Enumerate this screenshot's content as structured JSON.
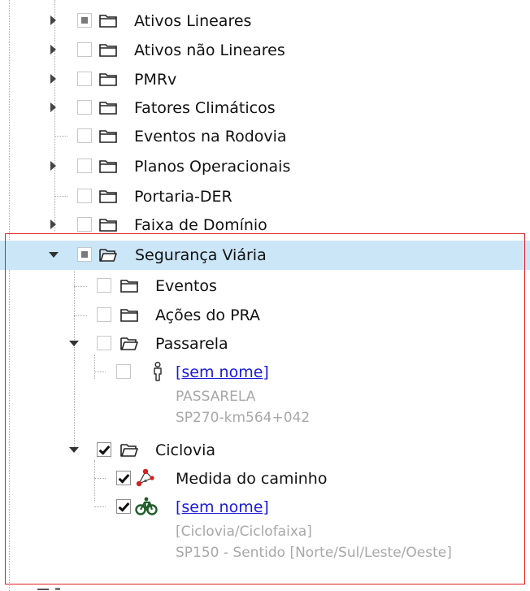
{
  "tree": {
    "items": [
      {
        "label": "Ativos Lineares",
        "state": "mixed",
        "expander": "collapsed",
        "icon": "folder-closed-icon"
      },
      {
        "label": "Ativos não Lineares",
        "state": "unchecked",
        "expander": "collapsed",
        "icon": "folder-closed-icon"
      },
      {
        "label": "PMRv",
        "state": "unchecked",
        "expander": "collapsed",
        "icon": "folder-closed-icon"
      },
      {
        "label": "Fatores Climáticos",
        "state": "unchecked",
        "expander": "collapsed",
        "icon": "folder-closed-icon"
      },
      {
        "label": "Eventos na Rodovia",
        "state": "unchecked",
        "expander": "none",
        "icon": "folder-closed-icon"
      },
      {
        "label": "Planos Operacionais",
        "state": "unchecked",
        "expander": "collapsed",
        "icon": "folder-closed-icon"
      },
      {
        "label": "Portaria-DER",
        "state": "unchecked",
        "expander": "none",
        "icon": "folder-closed-icon"
      },
      {
        "label": "Faixa de Domínio",
        "state": "unchecked",
        "expander": "collapsed",
        "icon": "folder-closed-icon"
      },
      {
        "label": "Segurança Viária",
        "state": "mixed",
        "expander": "expanded",
        "icon": "folder-open-icon",
        "selected": true
      },
      {
        "label": "Eventos",
        "state": "unchecked",
        "expander": "none",
        "icon": "folder-closed-icon"
      },
      {
        "label": "Ações do PRA",
        "state": "unchecked",
        "expander": "none",
        "icon": "folder-closed-icon"
      },
      {
        "label": "Passarela",
        "state": "unchecked",
        "expander": "expanded",
        "icon": "folder-open-icon"
      },
      {
        "label": "[sem nome]",
        "state": "unchecked",
        "expander": "none",
        "icon": "pedestrian-icon",
        "link": true,
        "details": [
          "PASSARELA",
          "SP270-km564+042"
        ]
      },
      {
        "label": "Ciclovia",
        "state": "checked",
        "expander": "expanded",
        "icon": "folder-open-icon"
      },
      {
        "label": "Medida do caminho",
        "state": "checked",
        "expander": "none",
        "icon": "path-measure-icon"
      },
      {
        "label": "[sem nome]",
        "state": "checked",
        "expander": "none",
        "icon": "bicycle-icon",
        "link": true,
        "details": [
          "[Ciclovia/Ciclofaixa]",
          "SP150 - Sentido [Norte/Sul/Leste/Oeste]"
        ]
      }
    ]
  },
  "colors": {
    "selection": "#cbe6f7",
    "highlight_frame": "#e02020",
    "link": "#1a1ad8",
    "detail_text": "#a8a8a8"
  }
}
